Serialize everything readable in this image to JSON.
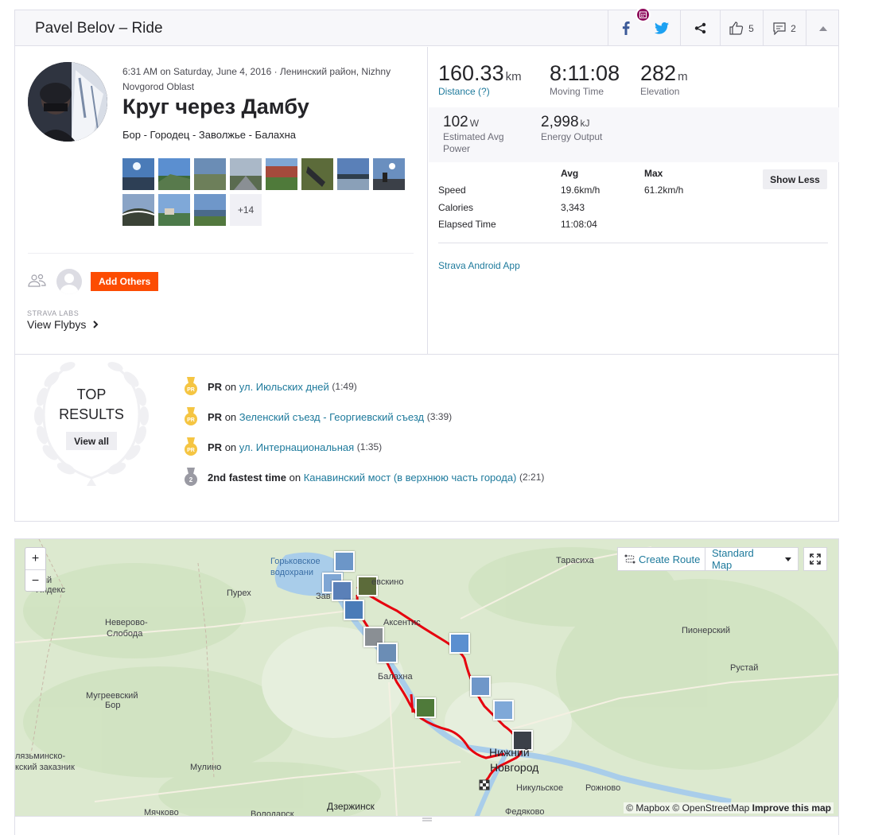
{
  "header": {
    "title": "Pavel Belov – Ride",
    "kudos_count": "5",
    "comments_count": "2",
    "notification_icon": "calendar-badge-icon"
  },
  "activity": {
    "datetime_location": "6:31 AM on Saturday, June 4, 2016 · Ленинский район, Nizhny Novgorod Oblast",
    "title": "Круг через Дамбу",
    "description": "Бор - Городец - Заволжье - Балахна",
    "more_photos": "+14",
    "add_others": "Add Others",
    "labs_label": "STRAVA LABS",
    "view_flybys": "View Flybys"
  },
  "stats": {
    "distance": {
      "value": "160.33",
      "unit": "km",
      "label": "Distance (?)"
    },
    "moving_time": {
      "value": "8:11:08",
      "label": "Moving Time"
    },
    "elevation": {
      "value": "282",
      "unit": "m",
      "label": "Elevation"
    },
    "power": {
      "value": "102",
      "unit": "W",
      "label": "Estimated Avg Power"
    },
    "energy": {
      "value": "2,998",
      "unit": "kJ",
      "label": "Energy Output"
    }
  },
  "more_stats": {
    "col_avg": "Avg",
    "col_max": "Max",
    "show_less": "Show Less",
    "rows": [
      {
        "label": "Speed",
        "avg": "19.6km/h",
        "max": "61.2km/h"
      },
      {
        "label": "Calories",
        "avg": "3,343",
        "max": ""
      },
      {
        "label": "Elapsed Time",
        "avg": "11:08:04",
        "max": ""
      }
    ],
    "device": "Strava Android App"
  },
  "top_results": {
    "title_line1": "TOP",
    "title_line2": "RESULTS",
    "view_all": "View all",
    "items": [
      {
        "badge": "PR",
        "achievement": "PR",
        "on": "on",
        "segment": "ул. Июльских дней",
        "time": "(1:49)"
      },
      {
        "badge": "PR",
        "achievement": "PR",
        "on": "on",
        "segment": "Зеленский съезд - Георгиевский съезд",
        "time": "(3:39)"
      },
      {
        "badge": "PR",
        "achievement": "PR",
        "on": "on",
        "segment": "ул. Интернациональная",
        "time": "(1:35)"
      },
      {
        "badge": "2",
        "achievement": "2nd fastest time",
        "on": "on",
        "segment": "Канавинский мост (в верхнюю часть города)",
        "time": "(2:21)"
      }
    ]
  },
  "map": {
    "zoom_in": "+",
    "zoom_out": "−",
    "create_route": "Create Route",
    "map_style": "Standard Map",
    "attribution_1": "© Mapbox © OpenStreetMap",
    "attribution_2": "Improve this map",
    "labels": {
      "gorkovskoe": "Горьковское",
      "vodokhran": "водохрани",
      "zav": "Зав",
      "evskino": "евскино",
      "tarasikha": "Тарасиха",
      "purekh": "Пурех",
      "aksentis": "Аксентис",
      "nevero": "Неверово-",
      "sloboda": "Слобода",
      "pionersky": "Пионерский",
      "rustay": "Рустай",
      "balakhna": "Балахна",
      "mugreevsky": "Мугреевский",
      "bor": "Бор",
      "nizhny1": "Нижний",
      "nizhny2": "Новгород",
      "klyazm1": "лязьминско-",
      "klyazm2": "кский заказник",
      "mulino": "Мулино",
      "nikulskoe": "Никульское",
      "rozhnovo": "Рожново",
      "dzerzhinsk": "Дзержинск",
      "myachkovo": "Мячково",
      "volodarsk": "Володарск",
      "fedyakovo": "Федяково",
      "nyj": "ный",
      "yandex": "Яндекс"
    }
  }
}
